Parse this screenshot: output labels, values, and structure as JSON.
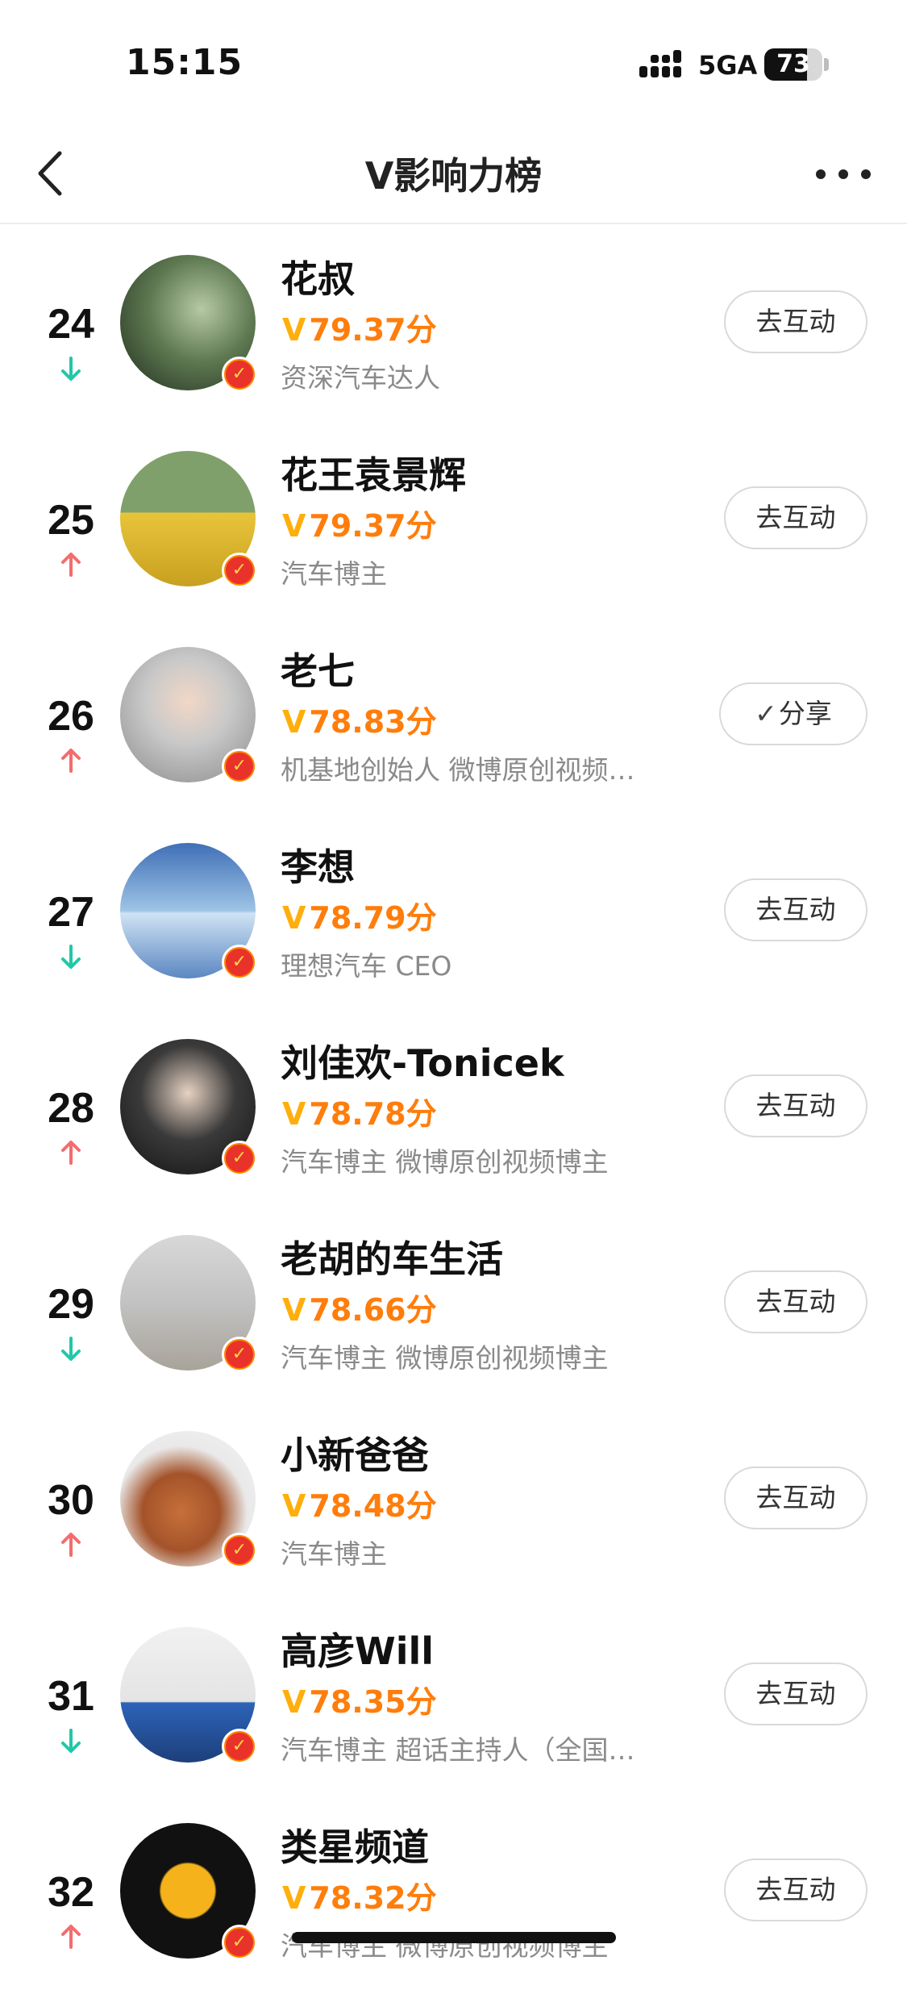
{
  "status_bar": {
    "time": "15:15",
    "network": "5GA",
    "battery_level": "73",
    "battery_fraction": 0.73
  },
  "nav": {
    "title": "V影响力榜",
    "back_icon": "chevron-left-icon",
    "more_icon": "more-dots-icon"
  },
  "colors": {
    "score": "#ff7d0b",
    "trend_up": "#f56c6c",
    "trend_down": "#22c7a8",
    "badge": "#ff8200"
  },
  "rankings": [
    {
      "rank": "24",
      "trend": "down",
      "name": "花叔",
      "score_mark": "V",
      "score": "79.37分",
      "desc": "资深汽车达人",
      "action": "去互动"
    },
    {
      "rank": "25",
      "trend": "up",
      "name": "花王袁景辉",
      "score_mark": "V",
      "score": "79.37分",
      "desc": "汽车博主",
      "action": "去互动"
    },
    {
      "rank": "26",
      "trend": "up",
      "name": "老七",
      "score_mark": "V",
      "score": "78.83分",
      "desc": "机基地创始人 微博原创视频…",
      "action": "分享",
      "action_icon": "check-icon"
    },
    {
      "rank": "27",
      "trend": "down",
      "name": "李想",
      "score_mark": "V",
      "score": "78.79分",
      "desc": "理想汽车 CEO",
      "action": "去互动"
    },
    {
      "rank": "28",
      "trend": "up",
      "name": "刘佳欢-Tonicek",
      "score_mark": "V",
      "score": "78.78分",
      "desc": "汽车博主 微博原创视频博主",
      "action": "去互动"
    },
    {
      "rank": "29",
      "trend": "down",
      "name": "老胡的车生活",
      "score_mark": "V",
      "score": "78.66分",
      "desc": "汽车博主 微博原创视频博主",
      "action": "去互动"
    },
    {
      "rank": "30",
      "trend": "up",
      "name": "小新爸爸",
      "score_mark": "V",
      "score": "78.48分",
      "desc": "汽车博主",
      "action": "去互动"
    },
    {
      "rank": "31",
      "trend": "down",
      "name": "高彦Will",
      "score_mark": "V",
      "score": "78.35分",
      "desc": "汽车博主 超话主持人（全国…",
      "action": "去互动"
    },
    {
      "rank": "32",
      "trend": "up",
      "name": "类星频道",
      "score_mark": "V",
      "score": "78.32分",
      "desc": "汽车博主 微博原创视频博主",
      "action": "去互动"
    }
  ]
}
